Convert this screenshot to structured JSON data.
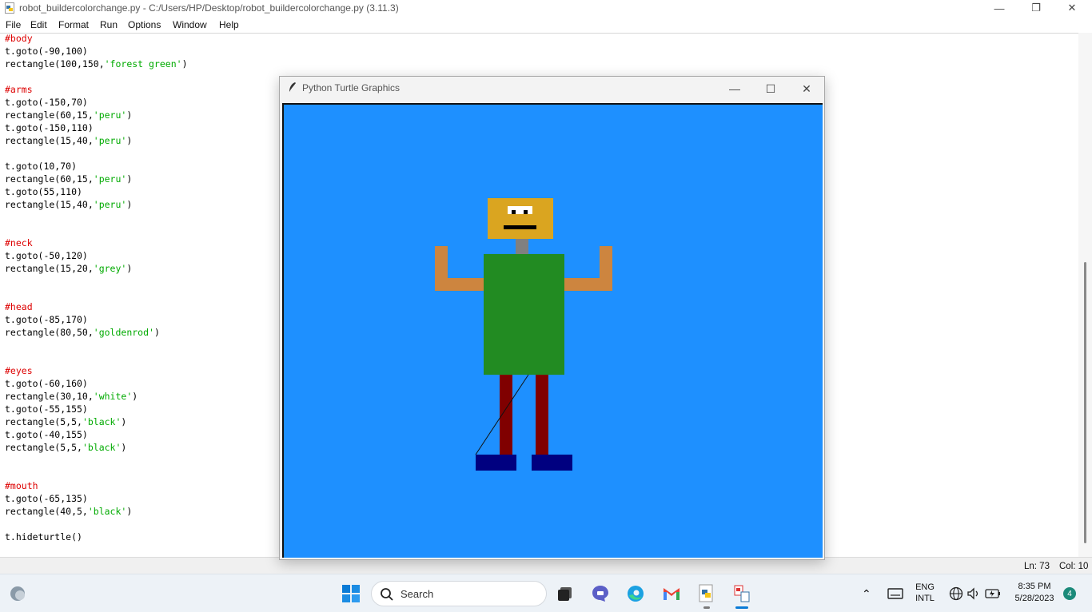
{
  "window": {
    "title": "robot_buildercolorchange.py - C:/Users/HP/Desktop/robot_buildercolorchange.py (3.11.3)"
  },
  "menu": [
    "File",
    "Edit",
    "Format",
    "Run",
    "Options",
    "Window",
    "Help"
  ],
  "code_lines": [
    {
      "kind": "comment",
      "text": "#body"
    },
    {
      "kind": "code",
      "text": "t.goto(-90,100)"
    },
    {
      "kind": "str",
      "pre": "rectangle(100,150,",
      "str": "'forest green'",
      "post": ")"
    },
    {
      "kind": "blank",
      "text": ""
    },
    {
      "kind": "comment",
      "text": "#arms"
    },
    {
      "kind": "code",
      "text": "t.goto(-150,70)"
    },
    {
      "kind": "str",
      "pre": "rectangle(60,15,",
      "str": "'peru'",
      "post": ")"
    },
    {
      "kind": "code",
      "text": "t.goto(-150,110)"
    },
    {
      "kind": "str",
      "pre": "rectangle(15,40,",
      "str": "'peru'",
      "post": ")"
    },
    {
      "kind": "blank",
      "text": ""
    },
    {
      "kind": "code",
      "text": "t.goto(10,70)"
    },
    {
      "kind": "str",
      "pre": "rectangle(60,15,",
      "str": "'peru'",
      "post": ")"
    },
    {
      "kind": "code",
      "text": "t.goto(55,110)"
    },
    {
      "kind": "str",
      "pre": "rectangle(15,40,",
      "str": "'peru'",
      "post": ")"
    },
    {
      "kind": "blank",
      "text": ""
    },
    {
      "kind": "blank",
      "text": ""
    },
    {
      "kind": "comment",
      "text": "#neck"
    },
    {
      "kind": "code",
      "text": "t.goto(-50,120)"
    },
    {
      "kind": "str",
      "pre": "rectangle(15,20,",
      "str": "'grey'",
      "post": ")"
    },
    {
      "kind": "blank",
      "text": ""
    },
    {
      "kind": "blank",
      "text": ""
    },
    {
      "kind": "comment",
      "text": "#head"
    },
    {
      "kind": "code",
      "text": "t.goto(-85,170)"
    },
    {
      "kind": "str",
      "pre": "rectangle(80,50,",
      "str": "'goldenrod'",
      "post": ")"
    },
    {
      "kind": "blank",
      "text": ""
    },
    {
      "kind": "blank",
      "text": ""
    },
    {
      "kind": "comment",
      "text": "#eyes"
    },
    {
      "kind": "code",
      "text": "t.goto(-60,160)"
    },
    {
      "kind": "str",
      "pre": "rectangle(30,10,",
      "str": "'white'",
      "post": ")"
    },
    {
      "kind": "code",
      "text": "t.goto(-55,155)"
    },
    {
      "kind": "str",
      "pre": "rectangle(5,5,",
      "str": "'black'",
      "post": ")"
    },
    {
      "kind": "code",
      "text": "t.goto(-40,155)"
    },
    {
      "kind": "str",
      "pre": "rectangle(5,5,",
      "str": "'black'",
      "post": ")"
    },
    {
      "kind": "blank",
      "text": ""
    },
    {
      "kind": "blank",
      "text": ""
    },
    {
      "kind": "comment",
      "text": "#mouth"
    },
    {
      "kind": "code",
      "text": "t.goto(-65,135)"
    },
    {
      "kind": "str",
      "pre": "rectangle(40,5,",
      "str": "'black'",
      "post": ")"
    },
    {
      "kind": "blank",
      "text": ""
    },
    {
      "kind": "code",
      "text": "t.hideturtle()"
    }
  ],
  "status": {
    "line": "Ln: 73",
    "col": "Col: 10"
  },
  "turtle_window": {
    "title": "Python Turtle Graphics",
    "background": "#1e90ff"
  },
  "taskbar": {
    "search_label": "Search",
    "lang_top": "ENG",
    "lang_bottom": "INTL",
    "time": "8:35 PM",
    "date": "5/28/2023",
    "notification_count": "4",
    "icons": [
      "windows-start-icon",
      "search-icon",
      "task-view-icon",
      "chat-icon",
      "edge-icon",
      "gmail-icon",
      "python-idle-icon",
      "turtle-app-icon"
    ]
  },
  "colors": {
    "forest_green": "#228b22",
    "peru": "#cd853f",
    "grey": "#808080",
    "goldenrod": "#daa520",
    "maroon_legs": "#800000",
    "navy_feet": "#000080",
    "comment_red": "#dd0000",
    "string_green": "#00aa00"
  }
}
